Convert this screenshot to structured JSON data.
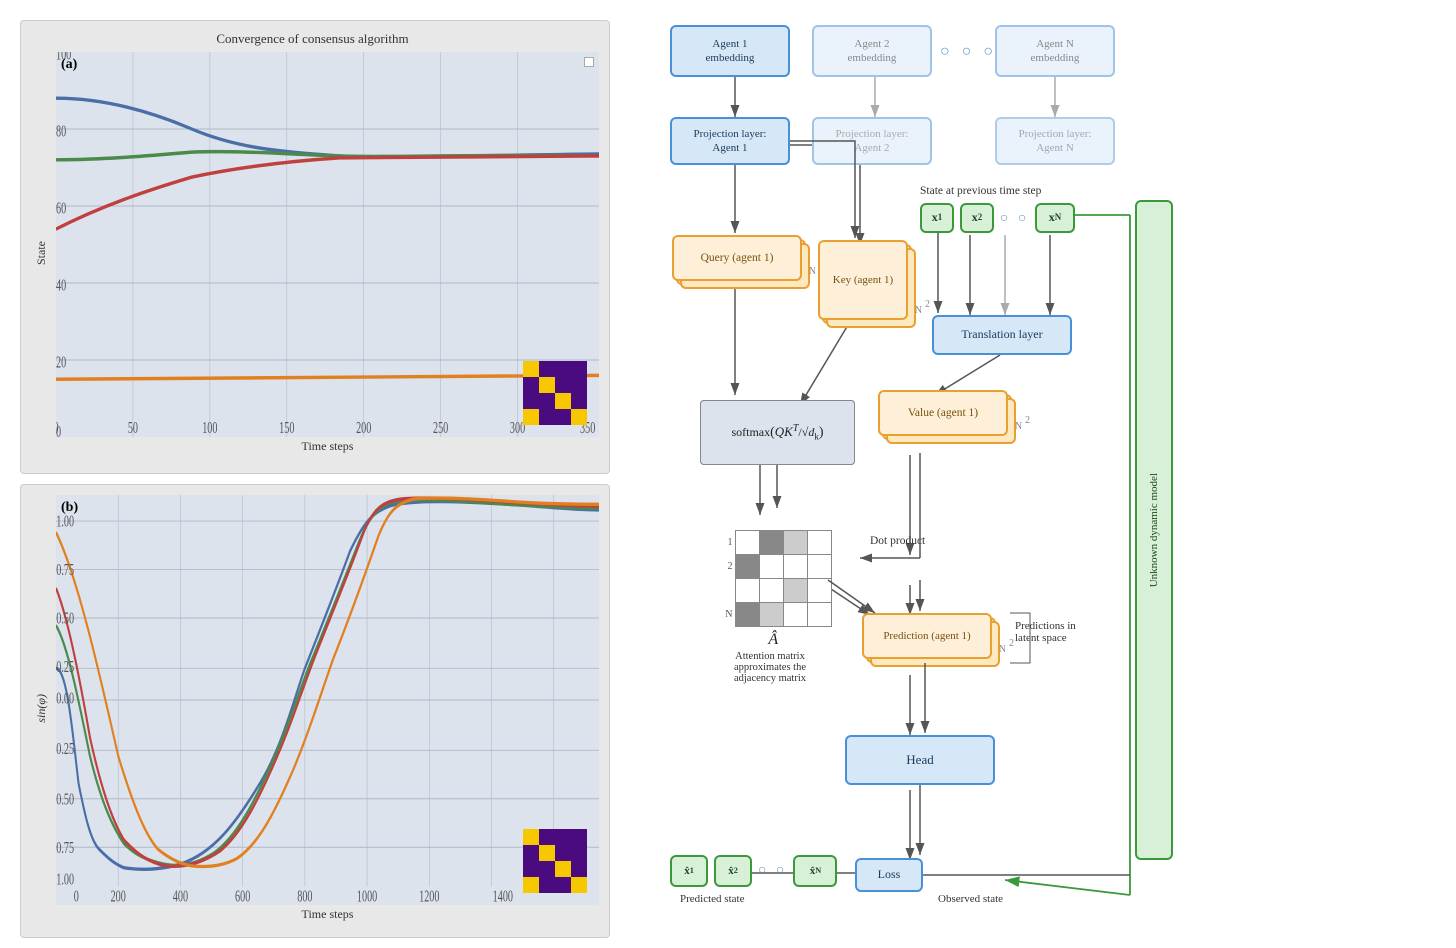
{
  "left": {
    "chart_a": {
      "title": "Convergence of consensus algorithm",
      "label": "(a)",
      "y_axis": "State",
      "x_axis": "Time steps",
      "x_ticks": [
        "0",
        "50",
        "100",
        "150",
        "200",
        "250",
        "300",
        "350"
      ],
      "y_ticks": [
        "0",
        "20",
        "40",
        "60",
        "80",
        "100"
      ]
    },
    "chart_b": {
      "label": "(b)",
      "y_axis": "sin(φ)",
      "x_axis": "Time steps",
      "x_ticks": [
        "0",
        "200",
        "400",
        "600",
        "800",
        "1000",
        "1200",
        "1400"
      ],
      "y_ticks": [
        "-1.00",
        "-0.75",
        "-0.50",
        "-0.25",
        "0.00",
        "0.25",
        "0.50",
        "0.75",
        "1.00"
      ]
    }
  },
  "right": {
    "agent_boxes": [
      {
        "id": "agent1",
        "label": "Agent 1\nembedding"
      },
      {
        "id": "agent2",
        "label": "Agent 2\nembedding"
      },
      {
        "id": "agentN",
        "label": "Agent N\nembedding"
      }
    ],
    "projection_boxes": [
      {
        "id": "proj1",
        "label": "Projection layer:\nAgent 1"
      },
      {
        "id": "proj2",
        "label": "Projection layer:\nAgent 2"
      },
      {
        "id": "projN",
        "label": "Projection layer:\nAgent N"
      }
    ],
    "state_label": "State at previous time step",
    "state_nodes": [
      "x₁",
      "x₂",
      "xₙ"
    ],
    "translation_layer": "Translation layer",
    "query_label": "Query (agent 1)",
    "key_label": "Key (agent 1)",
    "value_label": "Value (agent 1)",
    "prediction_label": "Prediction (agent 1)",
    "predictions_label": "Predictions in\nlatent space",
    "head_label": "Head",
    "loss_label": "Loss",
    "unknown_model_label": "Unknown dynamic model",
    "predicted_state_label": "Predicted state",
    "observed_state_label": "Observed state",
    "attn_label": "Â",
    "attn_desc": "Attention matrix\napproximates the\nadjacency matrix",
    "dot_product_label": "Dot product",
    "softmax_label": "softmax(QKᵀ / √dk)"
  }
}
